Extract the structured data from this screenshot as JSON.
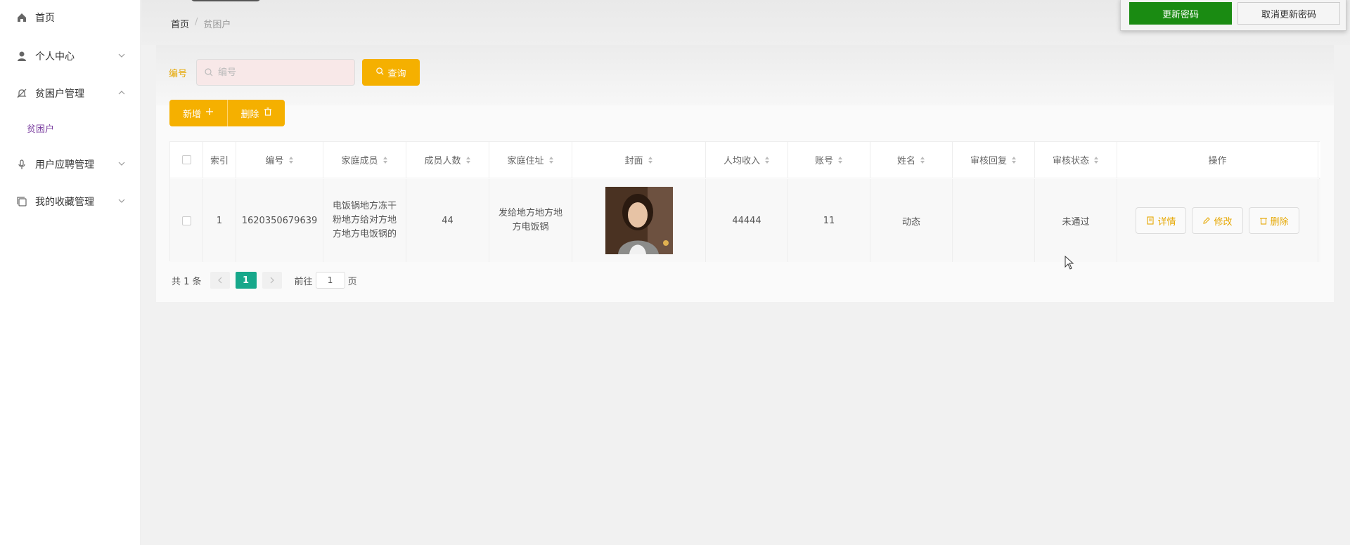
{
  "sidebar": {
    "items": [
      {
        "label": "首页",
        "icon": "home-icon"
      },
      {
        "label": "个人中心",
        "icon": "user-icon"
      },
      {
        "label": "贫困户管理",
        "icon": "bell-icon"
      },
      {
        "label": "用户应聘管理",
        "icon": "mic-icon"
      },
      {
        "label": "我的收藏管理",
        "icon": "copy-icon"
      }
    ],
    "submenu": {
      "label": "贫困户"
    }
  },
  "breadcrumb": {
    "home": "首页",
    "sep": "/",
    "current": "贫困户"
  },
  "search": {
    "label": "编号",
    "placeholder": "编号",
    "query_label": "查询"
  },
  "actions": {
    "add_label": "新增",
    "delete_label": "删除"
  },
  "table": {
    "headers": [
      "索引",
      "编号",
      "家庭成员",
      "成员人数",
      "家庭住址",
      "封面",
      "人均收入",
      "账号",
      "姓名",
      "审核回复",
      "审核状态",
      "操作"
    ],
    "rows": [
      {
        "index": "1",
        "number": "1620350679639",
        "members": "电饭锅地方冻干粉地方给对方地方地方电饭锅的",
        "member_count": "44",
        "address": "发给地方地方地方电饭锅",
        "income": "44444",
        "account": "11",
        "name": "动态",
        "reply": "",
        "status": "未通过"
      }
    ],
    "ops": {
      "detail": "详情",
      "edit": "修改",
      "delete": "删除"
    }
  },
  "pager": {
    "total": "共 1 条",
    "page": "1",
    "goto_label": "前往",
    "goto_value": "1",
    "page_unit": "页"
  },
  "popup": {
    "update": "更新密码",
    "cancel": "取消更新密码"
  },
  "colors": {
    "accent": "#f5b000",
    "pager_active": "#17a88b",
    "update_btn": "#1a8b12",
    "submenu": "#7b3fa0"
  }
}
